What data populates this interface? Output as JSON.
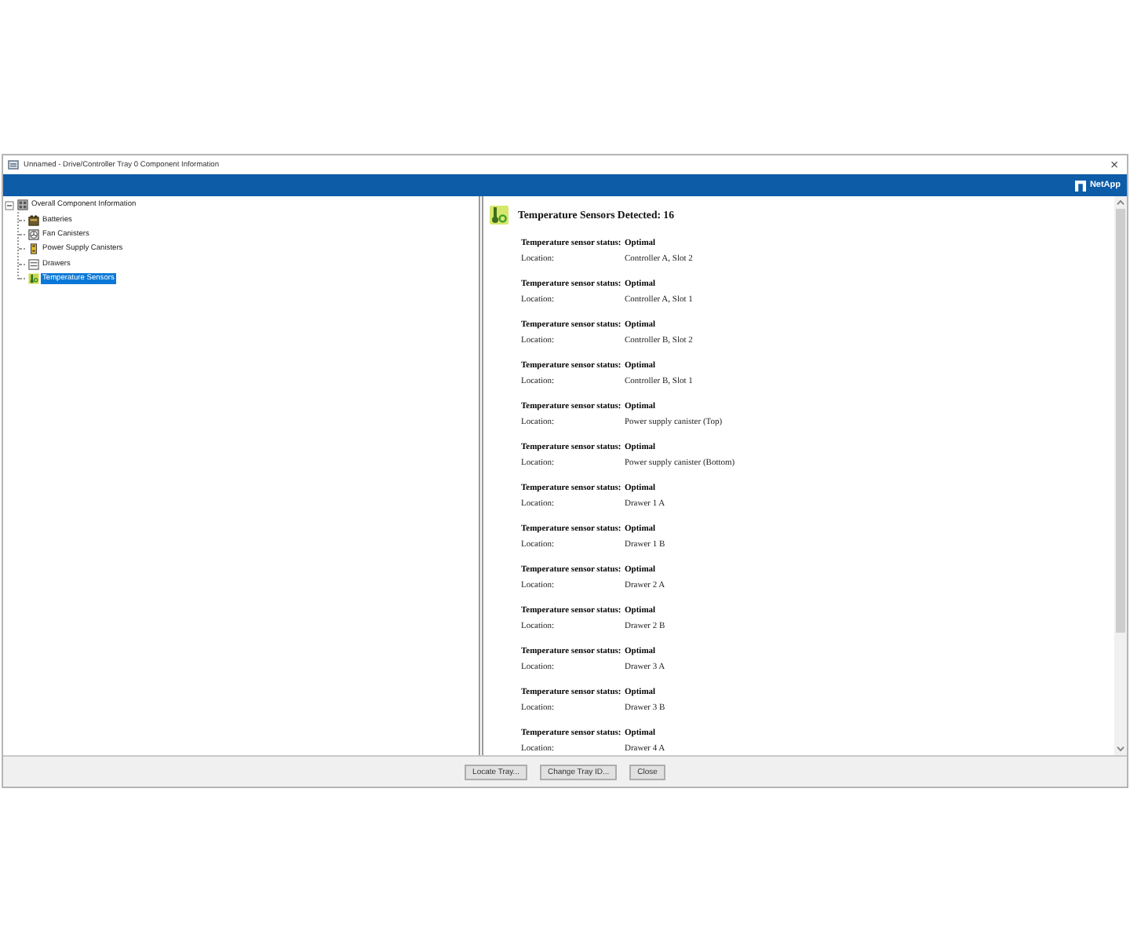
{
  "window": {
    "title": "Unnamed - Drive/Controller Tray 0 Component Information",
    "close": "×"
  },
  "banner": {
    "logo_text": "NetApp"
  },
  "tree": {
    "label": "Overall Component Information",
    "kind": "tray",
    "expanded": true,
    "selected": false,
    "children": [
      {
        "label": "Batteries",
        "kind": "battery",
        "selected": false
      },
      {
        "label": "Fan Canisters",
        "kind": "fan",
        "selected": false
      },
      {
        "label": "Power Supply Canisters",
        "kind": "power",
        "selected": false
      },
      {
        "label": "Drawers",
        "kind": "drawer",
        "selected": false
      },
      {
        "label": "Temperature Sensors",
        "kind": "sensor",
        "selected": true
      }
    ]
  },
  "details": {
    "heading": "Temperature Sensors Detected: 16",
    "sensors": [
      {
        "status_label": "Temperature sensor status:",
        "status": "Optimal",
        "location_label": "Location:",
        "location": "Controller A, Slot 2"
      },
      {
        "status_label": "Temperature sensor status:",
        "status": "Optimal",
        "location_label": "Location:",
        "location": "Controller A, Slot 1"
      },
      {
        "status_label": "Temperature sensor status:",
        "status": "Optimal",
        "location_label": "Location:",
        "location": "Controller B, Slot 2"
      },
      {
        "status_label": "Temperature sensor status:",
        "status": "Optimal",
        "location_label": "Location:",
        "location": "Controller B, Slot 1"
      },
      {
        "status_label": "Temperature sensor status:",
        "status": "Optimal",
        "location_label": "Location:",
        "location": "Power supply canister (Top)"
      },
      {
        "status_label": "Temperature sensor status:",
        "status": "Optimal",
        "location_label": "Location:",
        "location": "Power supply canister (Bottom)"
      },
      {
        "status_label": "Temperature sensor status:",
        "status": "Optimal",
        "location_label": "Location:",
        "location": "Drawer 1 A"
      },
      {
        "status_label": "Temperature sensor status:",
        "status": "Optimal",
        "location_label": "Location:",
        "location": "Drawer 1 B"
      },
      {
        "status_label": "Temperature sensor status:",
        "status": "Optimal",
        "location_label": "Location:",
        "location": "Drawer 2 A"
      },
      {
        "status_label": "Temperature sensor status:",
        "status": "Optimal",
        "location_label": "Location:",
        "location": "Drawer 2 B"
      },
      {
        "status_label": "Temperature sensor status:",
        "status": "Optimal",
        "location_label": "Location:",
        "location": "Drawer 3 A"
      },
      {
        "status_label": "Temperature sensor status:",
        "status": "Optimal",
        "location_label": "Location:",
        "location": "Drawer 3 B"
      },
      {
        "status_label": "Temperature sensor status:",
        "status": "Optimal",
        "location_label": "Location:",
        "location": "Drawer 4 A"
      }
    ]
  },
  "buttons": [
    {
      "label": "Locate Tray..."
    },
    {
      "label": "Change Tray ID..."
    },
    {
      "label": "Close"
    }
  ]
}
